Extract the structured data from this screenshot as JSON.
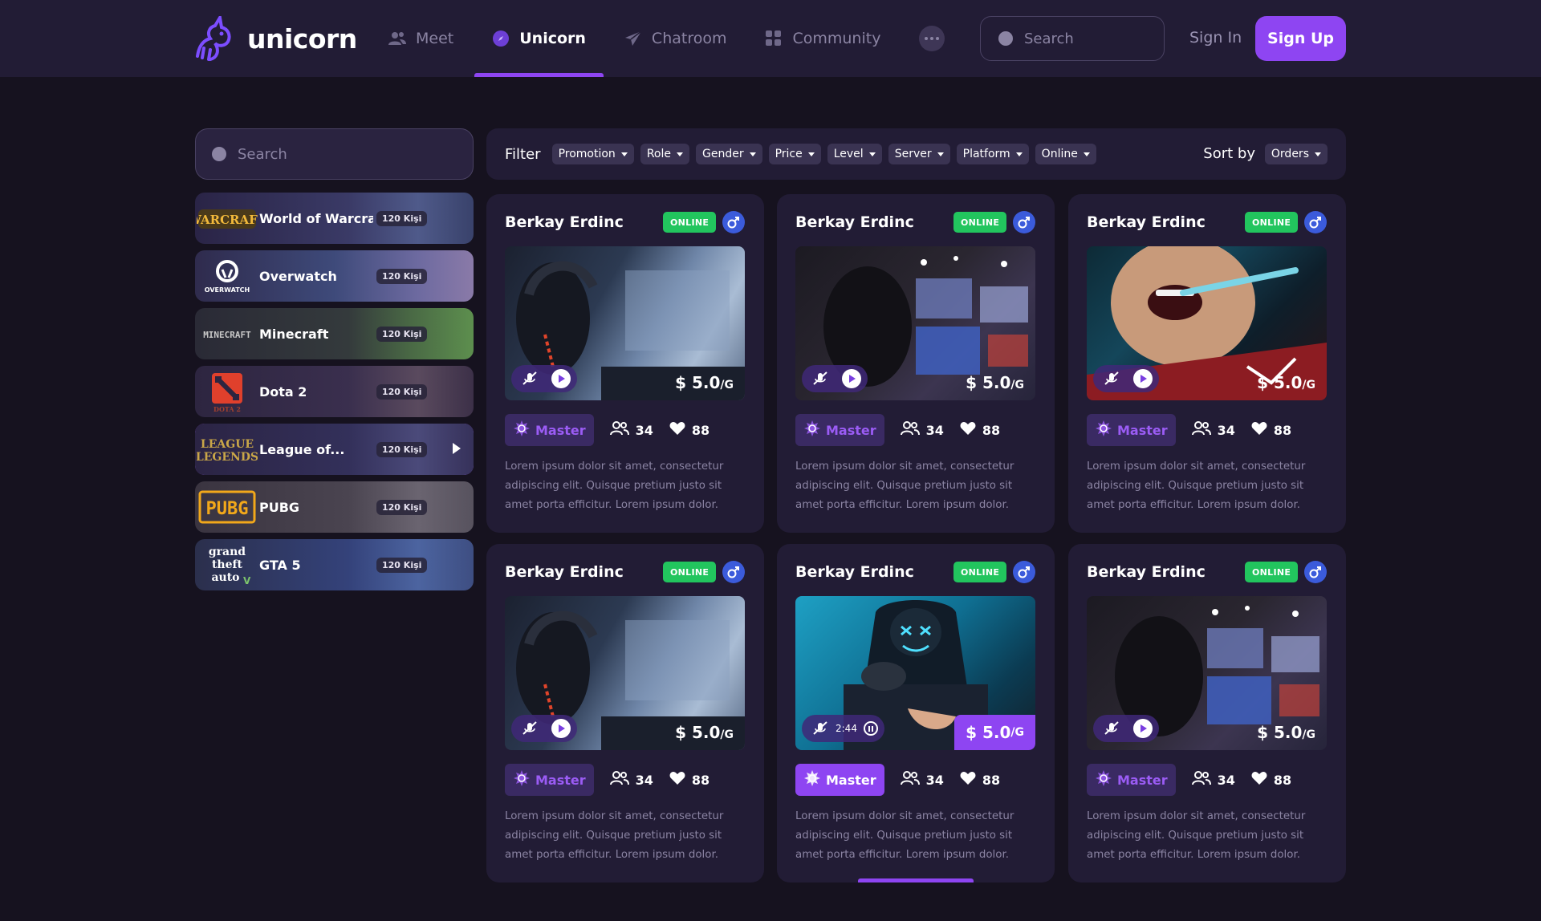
{
  "brand": {
    "name": "unicorn"
  },
  "nav": {
    "items": [
      {
        "label": "Meet",
        "icon": "users-icon",
        "active": false
      },
      {
        "label": "Unicorn",
        "icon": "compass-icon",
        "active": true
      },
      {
        "label": "Chatroom",
        "icon": "send-icon",
        "active": false
      },
      {
        "label": "Community",
        "icon": "grid-icon",
        "active": false
      }
    ],
    "more_icon": "more-dots-icon"
  },
  "header": {
    "search_placeholder": "Search",
    "signin_label": "Sign In",
    "signup_label": "Sign Up"
  },
  "sidebar": {
    "search_placeholder": "Search",
    "games": [
      {
        "name": "World of Warcraft",
        "badge": "120 Kişi",
        "logo_text": "WARCRAFT",
        "active": false
      },
      {
        "name": "Overwatch",
        "badge": "120 Kişi",
        "logo_text": "OVERWATCH",
        "active": false
      },
      {
        "name": "Minecraft",
        "badge": "120 Kişi",
        "logo_text": "MINECRAFT",
        "active": false
      },
      {
        "name": "Dota 2",
        "badge": "120 Kişi",
        "logo_text": "DOTA 2",
        "active": false
      },
      {
        "name": "League of...",
        "badge": "120 Kişi",
        "logo_text": "LEAGUE OF LEGENDS",
        "active": true
      },
      {
        "name": "PUBG",
        "badge": "120 Kişi",
        "logo_text": "PUBG",
        "active": false
      },
      {
        "name": "GTA 5",
        "badge": "120 Kişi",
        "logo_text": "grand theft auto",
        "active": false
      }
    ]
  },
  "filter": {
    "label": "Filter",
    "chips": [
      "Promotion",
      "Role",
      "Gender",
      "Price",
      "Level",
      "Server",
      "Platform",
      "Online"
    ],
    "sort_label": "Sort by",
    "sort_value": "Orders"
  },
  "colors": {
    "accent": "#8e45f2",
    "online": "#22c55e",
    "male": "#3b5bdb",
    "bg": "#16121f",
    "panel": "#221c35"
  },
  "cards": [
    {
      "name": "Berkay Erdinc",
      "status": "ONLINE",
      "price": "$ 5.0",
      "unit": "/G",
      "level": "Master",
      "followers": "34",
      "likes": "88",
      "scene": "headset",
      "desc": "Lorem ipsum dolor sit amet, consectetur adipiscing elit. Quisque pretium justo sit amet porta efficitur. Lorem ipsum dolor."
    },
    {
      "name": "Berkay Erdinc",
      "status": "ONLINE",
      "price": "$ 5.0",
      "unit": "/G",
      "level": "Master",
      "followers": "34",
      "likes": "88",
      "scene": "arena",
      "desc": "Lorem ipsum dolor sit amet, consectetur adipiscing elit. Quisque pretium justo sit amet porta efficitur. Lorem ipsum dolor."
    },
    {
      "name": "Berkay Erdinc",
      "status": "ONLINE",
      "price": "$ 5.0",
      "unit": "/G",
      "level": "Master",
      "followers": "34",
      "likes": "88",
      "scene": "mic",
      "desc": "Lorem ipsum dolor sit amet, consectetur adipiscing elit. Quisque pretium justo sit amet porta efficitur. Lorem ipsum dolor."
    },
    {
      "name": "Berkay Erdinc",
      "status": "ONLINE",
      "price": "$ 5.0",
      "unit": "/G",
      "level": "Master",
      "followers": "34",
      "likes": "88",
      "scene": "headset",
      "desc": "Lorem ipsum dolor sit amet, consectetur adipiscing elit. Quisque pretium justo sit amet porta efficitur. Lorem ipsum dolor."
    },
    {
      "name": "Berkay Erdinc",
      "status": "ONLINE",
      "price": "$ 5.0",
      "unit": "/G",
      "level": "Master",
      "followers": "34",
      "likes": "88",
      "scene": "mask",
      "playing": true,
      "time": "2:44",
      "desc": "Lorem ipsum dolor sit amet, consectetur adipiscing elit. Quisque pretium justo sit amet porta efficitur. Lorem ipsum dolor."
    },
    {
      "name": "Berkay Erdinc",
      "status": "ONLINE",
      "price": "$ 5.0",
      "unit": "/G",
      "level": "Master",
      "followers": "34",
      "likes": "88",
      "scene": "arena",
      "desc": "Lorem ipsum dolor sit amet, consectetur adipiscing elit. Quisque pretium justo sit amet porta efficitur. Lorem ipsum dolor."
    }
  ]
}
